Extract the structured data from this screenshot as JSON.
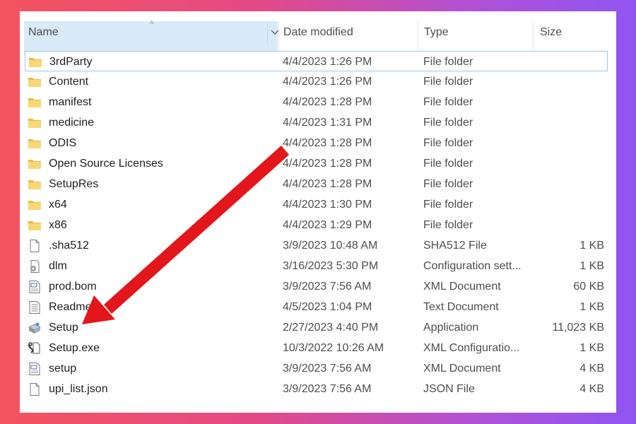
{
  "columns": {
    "name": "Name",
    "date_modified": "Date modified",
    "type": "Type",
    "size": "Size"
  },
  "files": [
    {
      "name": "3rdParty",
      "date": "4/4/2023 1:26 PM",
      "type": "File folder",
      "size": "",
      "icon": "folder-icon",
      "selected": true
    },
    {
      "name": "Content",
      "date": "4/4/2023 1:26 PM",
      "type": "File folder",
      "size": "",
      "icon": "folder-icon"
    },
    {
      "name": "manifest",
      "date": "4/4/2023 1:28 PM",
      "type": "File folder",
      "size": "",
      "icon": "folder-icon"
    },
    {
      "name": "medicine",
      "date": "4/4/2023 1:31 PM",
      "type": "File folder",
      "size": "",
      "icon": "folder-icon"
    },
    {
      "name": "ODIS",
      "date": "4/4/2023 1:28 PM",
      "type": "File folder",
      "size": "",
      "icon": "folder-icon"
    },
    {
      "name": "Open Source Licenses",
      "date": "4/4/2023 1:28 PM",
      "type": "File folder",
      "size": "",
      "icon": "folder-icon"
    },
    {
      "name": "SetupRes",
      "date": "4/4/2023 1:28 PM",
      "type": "File folder",
      "size": "",
      "icon": "folder-icon"
    },
    {
      "name": "x64",
      "date": "4/4/2023 1:30 PM",
      "type": "File folder",
      "size": "",
      "icon": "folder-icon"
    },
    {
      "name": "x86",
      "date": "4/4/2023 1:29 PM",
      "type": "File folder",
      "size": "",
      "icon": "folder-icon"
    },
    {
      "name": ".sha512",
      "date": "3/9/2023 10:48 AM",
      "type": "SHA512 File",
      "size": "1 KB",
      "icon": "blank-file-icon"
    },
    {
      "name": "dlm",
      "date": "3/16/2023 5:30 PM",
      "type": "Configuration sett...",
      "size": "1 KB",
      "icon": "config-file-icon"
    },
    {
      "name": "prod.bom",
      "date": "3/9/2023 7:56 AM",
      "type": "XML Document",
      "size": "60 KB",
      "icon": "xml-file-icon"
    },
    {
      "name": "Readme",
      "date": "4/5/2023 1:04 PM",
      "type": "Text Document",
      "size": "1 KB",
      "icon": "text-file-icon"
    },
    {
      "name": "Setup",
      "date": "2/27/2023 4:40 PM",
      "type": "Application",
      "size": "11,023 KB",
      "icon": "setup-app-icon"
    },
    {
      "name": "Setup.exe",
      "date": "10/3/2022 10:26 AM",
      "type": "XML Configuratio...",
      "size": "1 KB",
      "icon": "xml-config-file-icon"
    },
    {
      "name": "setup",
      "date": "3/9/2023 7:56 AM",
      "type": "XML Document",
      "size": "4 KB",
      "icon": "xml-file-icon"
    },
    {
      "name": "upi_list.json",
      "date": "3/9/2023 7:56 AM",
      "type": "JSON File",
      "size": "4 KB",
      "icon": "blank-file-icon"
    }
  ],
  "colors": {
    "background_left": "#f4545e",
    "background_right": "#8f55f3",
    "name_header_bg": "#d9ebf9",
    "selection_border": "#99c9ef",
    "annotation_arrow": "#e3161b",
    "folder": "#f8d775"
  },
  "annotation": {
    "icon": "red-arrow-icon",
    "target": "Setup"
  }
}
